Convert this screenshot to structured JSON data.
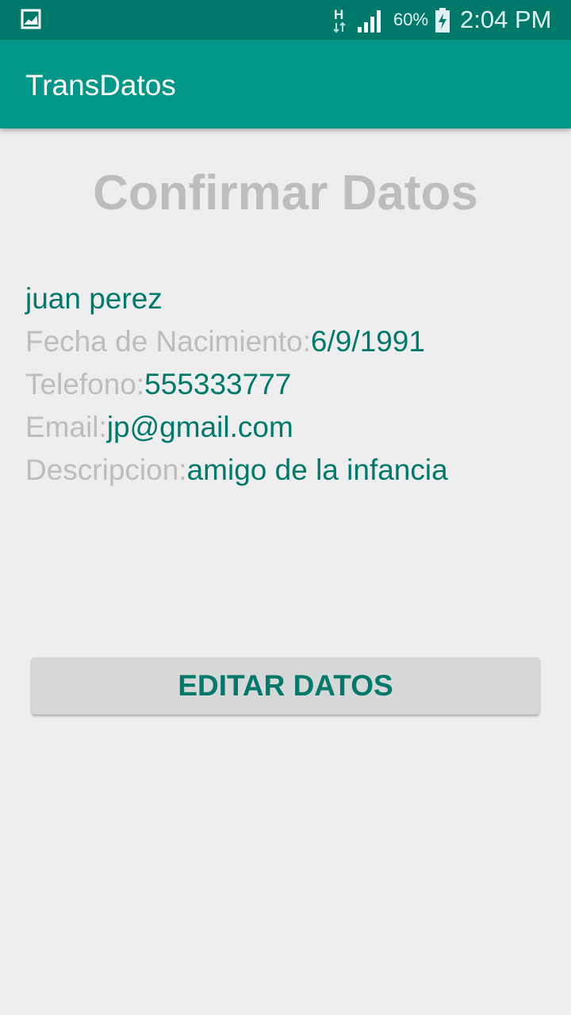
{
  "status_bar": {
    "left_icon": "image-notification-icon",
    "network_type": "H",
    "signal_icon": "cell-signal-icon",
    "battery_percent": "60%",
    "battery_icon": "battery-charging-icon",
    "time": "2:04 PM"
  },
  "app_bar": {
    "title": "TransDatos",
    "color": "#009688"
  },
  "main": {
    "title": "Confirmar Datos",
    "name": "juan perez",
    "fields": [
      {
        "label": "Fecha de Nacimiento:",
        "value": "6/9/1991"
      },
      {
        "label": "Telefono:",
        "value": "555333777"
      },
      {
        "label": "Email:",
        "value": "jp@gmail.com"
      },
      {
        "label": "Descripcion:",
        "value": "amigo de la infancia"
      }
    ],
    "edit_button_label": "EDITAR DATOS"
  },
  "colors": {
    "status_bar": "#00796b",
    "accent_text": "#00796b",
    "label_text": "#bdbdbd",
    "background": "#eeeeee"
  }
}
